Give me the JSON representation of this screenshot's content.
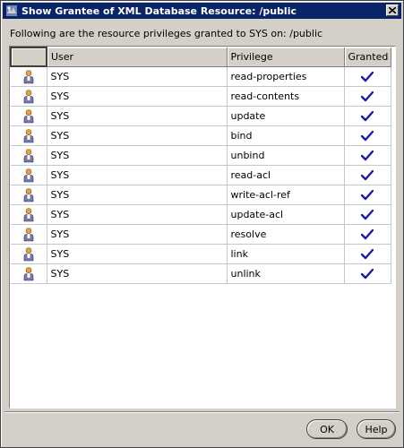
{
  "window": {
    "title": "Show Grantee of XML Database Resource: /public"
  },
  "description": "Following are the resource privileges granted to SYS on: /public",
  "table": {
    "columns": [
      "",
      "User",
      "Privilege",
      "Granted"
    ],
    "rows": [
      {
        "user": "SYS",
        "privilege": "read-properties",
        "granted": true
      },
      {
        "user": "SYS",
        "privilege": "read-contents",
        "granted": true
      },
      {
        "user": "SYS",
        "privilege": "update",
        "granted": true
      },
      {
        "user": "SYS",
        "privilege": "bind",
        "granted": true
      },
      {
        "user": "SYS",
        "privilege": "unbind",
        "granted": true
      },
      {
        "user": "SYS",
        "privilege": "read-acl",
        "granted": true
      },
      {
        "user": "SYS",
        "privilege": "write-acl-ref",
        "granted": true
      },
      {
        "user": "SYS",
        "privilege": "update-acl",
        "granted": true
      },
      {
        "user": "SYS",
        "privilege": "resolve",
        "granted": true
      },
      {
        "user": "SYS",
        "privilege": "link",
        "granted": true
      },
      {
        "user": "SYS",
        "privilege": "unlink",
        "granted": true
      }
    ]
  },
  "buttons": {
    "ok": "OK",
    "help": "Help"
  },
  "icons": {
    "app": "database-app-icon",
    "close": "close-icon",
    "row": "user-icon",
    "granted": "checkmark-icon"
  },
  "colors": {
    "title_bar": "#0a246a",
    "check": "#1a1aa8"
  }
}
